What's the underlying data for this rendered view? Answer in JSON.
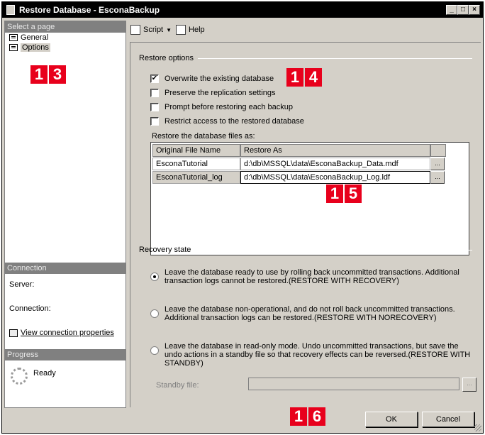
{
  "window": {
    "title": "Restore Database - EsconaBackup",
    "buttons": [
      "_",
      "□",
      "×"
    ]
  },
  "left": {
    "select_page_header": "Select a page",
    "pages": [
      {
        "label": "General",
        "icon": "page-icon"
      },
      {
        "label": "Options",
        "icon": "page-icon",
        "selected": true
      }
    ],
    "connection_header": "Connection",
    "server_label": "Server:",
    "connection_label": "Connection:",
    "view_props_link": "View connection properties",
    "progress_header": "Progress",
    "progress_status": "Ready"
  },
  "toolbar": {
    "script_label": "Script",
    "help_label": "Help"
  },
  "restore_options": {
    "group_title": "Restore options",
    "checkboxes": [
      {
        "label": "Overwrite the existing database",
        "checked": true
      },
      {
        "label": "Preserve the replication settings",
        "checked": false
      },
      {
        "label": "Prompt before restoring each backup",
        "checked": false
      },
      {
        "label": "Restrict access to the restored database",
        "checked": false
      }
    ],
    "files_label": "Restore the database files as:",
    "columns": [
      "Original File Name",
      "Restore As"
    ],
    "rows": [
      {
        "original": "EsconaTutorial",
        "restore_as": "d:\\db\\MSSQL\\data\\EsconaBackup_Data.mdf"
      },
      {
        "original": "EsconaTutorial_log",
        "restore_as": "d:\\db\\MSSQL\\data\\EsconaBackup_Log.ldf"
      }
    ],
    "ellipsis": "..."
  },
  "recovery": {
    "group_title": "Recovery state",
    "options": [
      {
        "text": "Leave the database ready to use by rolling back uncommitted transactions. Additional transaction logs cannot be restored.(RESTORE WITH RECOVERY)",
        "checked": true
      },
      {
        "text": "Leave the database non-operational, and do not roll back uncommitted transactions. Additional transaction logs can be restored.(RESTORE WITH NORECOVERY)",
        "checked": false
      },
      {
        "text": "Leave the database in read-only mode. Undo uncommitted transactions, but save the undo actions in a standby file so that recovery effects can be reversed.(RESTORE WITH STANDBY)",
        "checked": false
      }
    ],
    "standby_label": "Standby file:"
  },
  "footer": {
    "ok": "OK",
    "cancel": "Cancel"
  },
  "callouts": {
    "c13": [
      "1",
      "3"
    ],
    "c14": [
      "1",
      "4"
    ],
    "c15": [
      "1",
      "5"
    ],
    "c16": [
      "1",
      "6"
    ]
  },
  "colors": {
    "callout": "#e8001c",
    "dialog_bg": "#d4d0c8"
  }
}
